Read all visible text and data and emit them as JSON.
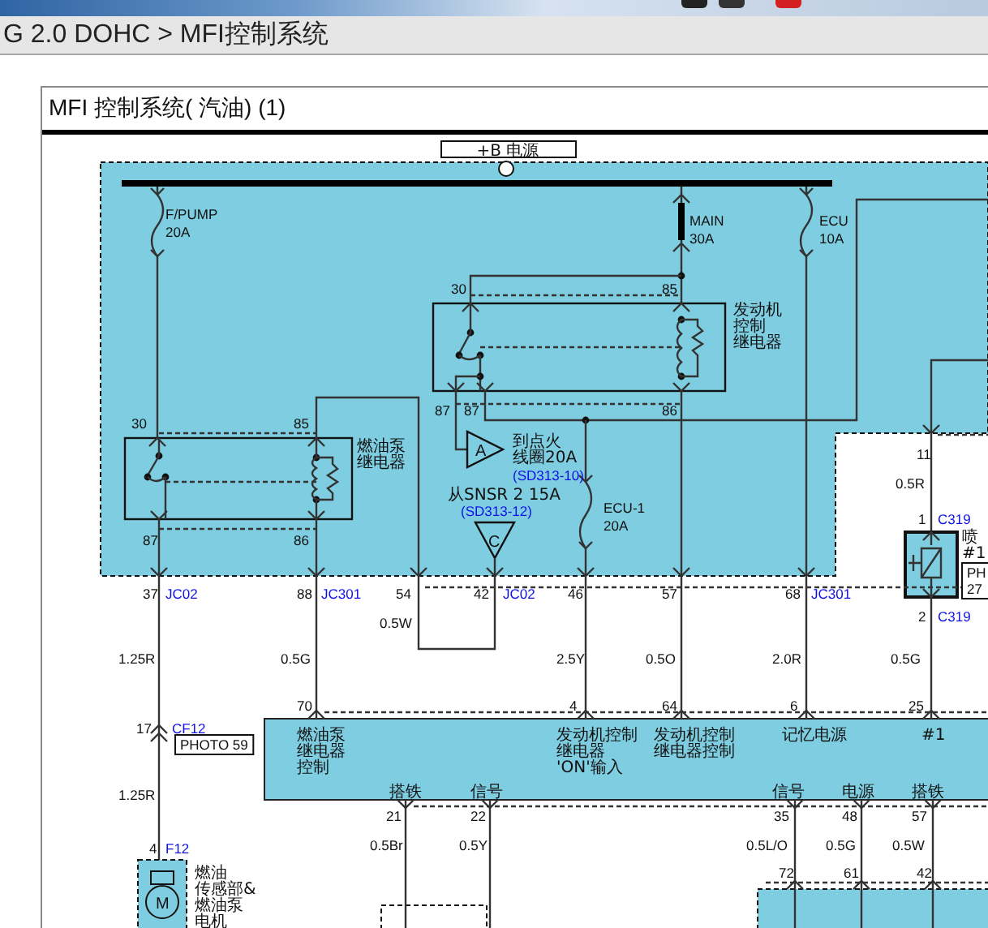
{
  "breadcrumb": "G 2.0 DOHC > MFI控制系统",
  "panel_title": "MFI 控制系统( 汽油) (1)",
  "diagram": {
    "power_source": "+B 电源",
    "labels": [
      {
        "kind": "fuse",
        "text": "F/PUMP"
      },
      {
        "kind": "fuse",
        "text": "20A"
      },
      {
        "kind": "fuse",
        "text": "MAIN"
      },
      {
        "kind": "fuse",
        "text": "30A"
      },
      {
        "kind": "fuse",
        "text": "ECU"
      },
      {
        "kind": "fuse",
        "text": "10A"
      },
      {
        "kind": "pin",
        "text": "30"
      },
      {
        "kind": "pin",
        "text": "85"
      },
      {
        "kind": "note",
        "lines": [
          "发动机",
          "控制",
          "继电器"
        ]
      },
      {
        "kind": "pin",
        "text": "87"
      },
      {
        "kind": "pin",
        "text": "87"
      },
      {
        "kind": "pin",
        "text": "86"
      },
      {
        "kind": "pin",
        "text": "30"
      },
      {
        "kind": "pin",
        "text": "85"
      },
      {
        "kind": "note",
        "lines": [
          "燃油泵",
          "继电器"
        ]
      },
      {
        "kind": "note",
        "lines": [
          "到点火",
          "线圈20A"
        ]
      },
      {
        "kind": "ref",
        "text": "(SD313-10)"
      },
      {
        "kind": "pin",
        "text": "11"
      },
      {
        "kind": "wire",
        "text": "0.5R"
      },
      {
        "kind": "note",
        "lines": [
          "从SNSR 2 15A"
        ]
      },
      {
        "kind": "ref",
        "text": "(SD313-12)"
      },
      {
        "kind": "fuse",
        "text": "ECU-1"
      },
      {
        "kind": "fuse",
        "text": "20A"
      },
      {
        "kind": "pin",
        "text": "1"
      },
      {
        "kind": "connector",
        "text": "C319"
      },
      {
        "kind": "note",
        "lines": [
          "喷",
          "#1"
        ]
      },
      {
        "kind": "photo",
        "lines": [
          "PH",
          "27"
        ]
      },
      {
        "kind": "pin",
        "text": "87"
      },
      {
        "kind": "pin",
        "text": "86"
      },
      {
        "kind": "pin",
        "text": "37"
      },
      {
        "kind": "connector",
        "text": "JC02"
      },
      {
        "kind": "pin",
        "text": "88"
      },
      {
        "kind": "connector",
        "text": "JC301"
      },
      {
        "kind": "pin",
        "text": "54"
      },
      {
        "kind": "pin",
        "text": "42"
      },
      {
        "kind": "connector",
        "text": "JC02"
      },
      {
        "kind": "pin",
        "text": "46"
      },
      {
        "kind": "pin",
        "text": "57"
      },
      {
        "kind": "pin",
        "text": "68"
      },
      {
        "kind": "connector",
        "text": "JC301"
      },
      {
        "kind": "pin",
        "text": "2"
      },
      {
        "kind": "connector",
        "text": "C319"
      },
      {
        "kind": "wire",
        "text": "0.5W"
      },
      {
        "kind": "wire",
        "text": "1.25R"
      },
      {
        "kind": "wire",
        "text": "0.5G"
      },
      {
        "kind": "wire",
        "text": "2.5Y"
      },
      {
        "kind": "wire",
        "text": "0.5O"
      },
      {
        "kind": "wire",
        "text": "2.0R"
      },
      {
        "kind": "wire",
        "text": "0.5G"
      },
      {
        "kind": "pin",
        "text": "70"
      },
      {
        "kind": "pin",
        "text": "4"
      },
      {
        "kind": "pin",
        "text": "64"
      },
      {
        "kind": "pin",
        "text": "6"
      },
      {
        "kind": "pin",
        "text": "25"
      },
      {
        "kind": "pin",
        "text": "17"
      },
      {
        "kind": "connector",
        "text": "CF12"
      },
      {
        "kind": "photo",
        "lines": [
          "PHOTO 59"
        ]
      },
      {
        "kind": "note",
        "lines": [
          "燃油泵",
          "继电器",
          "控制"
        ]
      },
      {
        "kind": "note",
        "lines": [
          "发动机控制",
          "继电器",
          "'ON'输入"
        ]
      },
      {
        "kind": "note",
        "lines": [
          "发动机控制",
          "继电器控制"
        ]
      },
      {
        "kind": "note",
        "lines": [
          "记忆电源"
        ]
      },
      {
        "kind": "note",
        "lines": [
          "#1"
        ]
      },
      {
        "kind": "wire",
        "text": "1.25R"
      },
      {
        "kind": "note",
        "lines": [
          "搭铁"
        ]
      },
      {
        "kind": "note",
        "lines": [
          "信号"
        ]
      },
      {
        "kind": "note",
        "lines": [
          "信号"
        ]
      },
      {
        "kind": "note",
        "lines": [
          "电源"
        ]
      },
      {
        "kind": "note",
        "lines": [
          "搭铁"
        ]
      },
      {
        "kind": "pin",
        "text": "21"
      },
      {
        "kind": "pin",
        "text": "22"
      },
      {
        "kind": "pin",
        "text": "35"
      },
      {
        "kind": "pin",
        "text": "48"
      },
      {
        "kind": "pin",
        "text": "57"
      },
      {
        "kind": "pin",
        "text": "4"
      },
      {
        "kind": "connector",
        "text": "F12"
      },
      {
        "kind": "wire",
        "text": "0.5Br"
      },
      {
        "kind": "wire",
        "text": "0.5Y"
      },
      {
        "kind": "wire",
        "text": "0.5L/O"
      },
      {
        "kind": "wire",
        "text": "0.5G"
      },
      {
        "kind": "wire",
        "text": "0.5W"
      },
      {
        "kind": "note",
        "lines": [
          "燃油",
          "传感部&",
          "燃油泵",
          "电机"
        ]
      },
      {
        "kind": "pin",
        "text": "72"
      },
      {
        "kind": "pin",
        "text": "61"
      },
      {
        "kind": "pin",
        "text": "42"
      },
      {
        "kind": "symbol",
        "text": "A"
      },
      {
        "kind": "symbol",
        "text": "C"
      },
      {
        "kind": "symbol",
        "text": "M"
      }
    ]
  }
}
